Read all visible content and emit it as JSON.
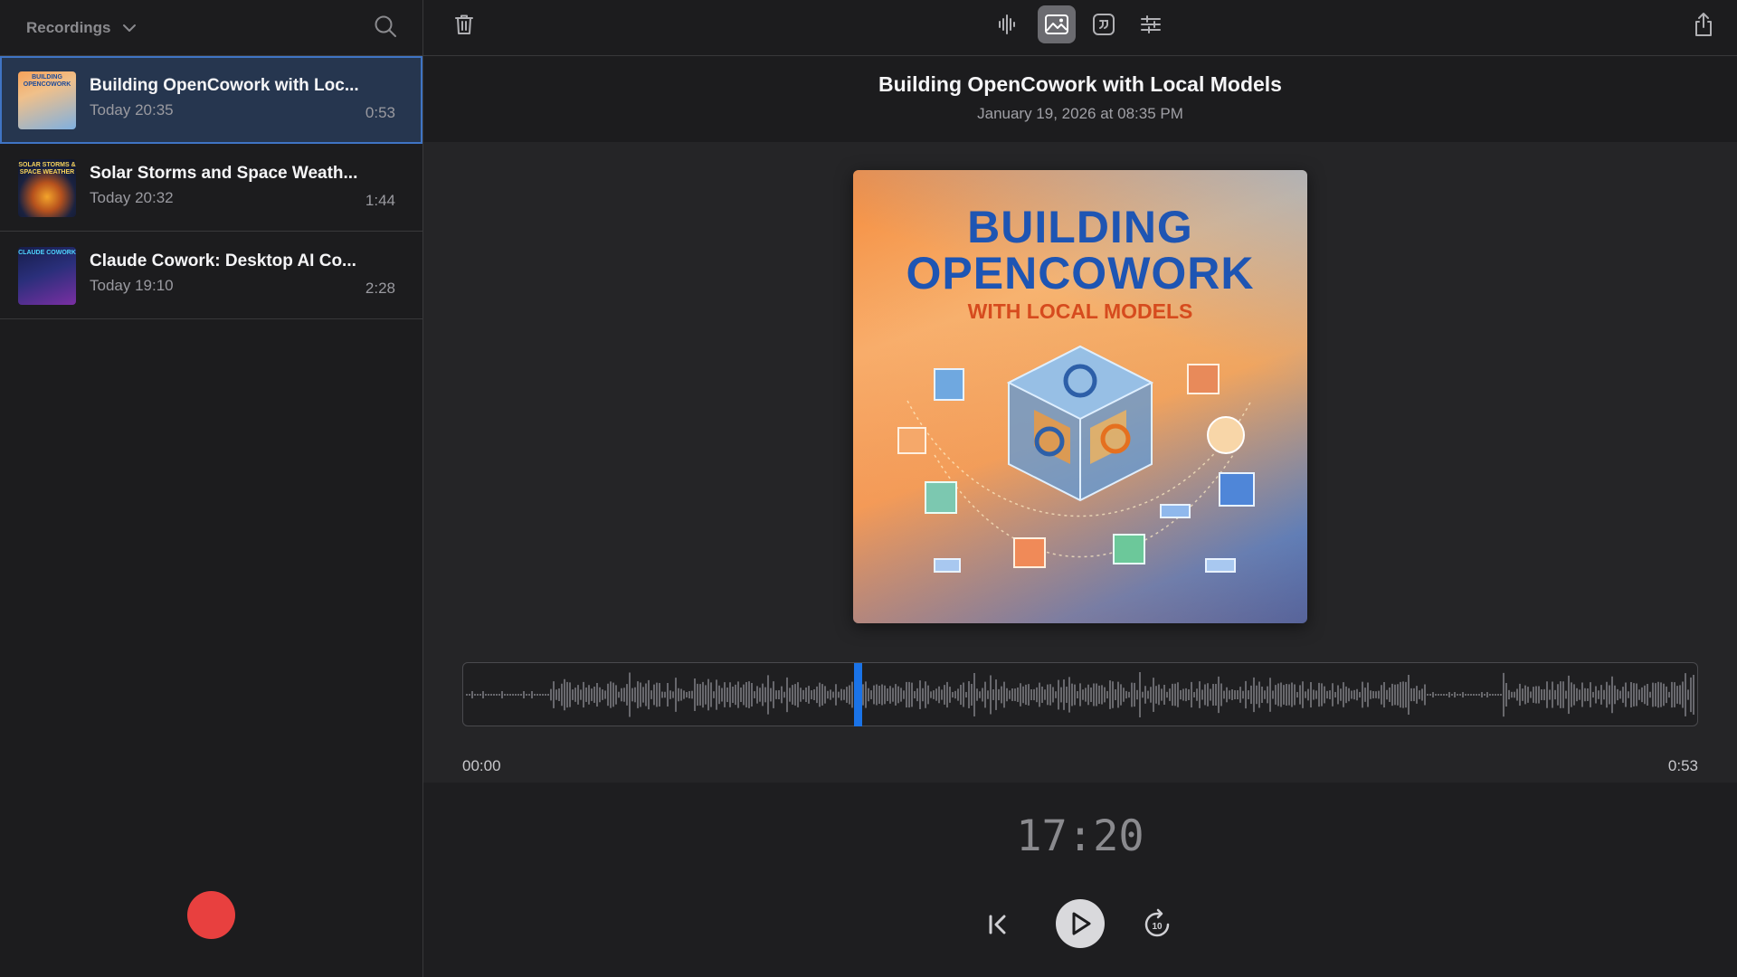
{
  "sidebar": {
    "header_label": "Recordings",
    "recordings": [
      {
        "title": "Building OpenCowork with Loc...",
        "date": "Today 20:35",
        "duration": "0:53",
        "thumb_text": "BUILDING OPENCOWORK"
      },
      {
        "title": "Solar Storms and Space Weath...",
        "date": "Today 20:32",
        "duration": "1:44",
        "thumb_text": "SOLAR STORMS & SPACE WEATHER"
      },
      {
        "title": "Claude Cowork: Desktop AI Co...",
        "date": "Today 19:10",
        "duration": "2:28",
        "thumb_text": "CLAUDE COWORK"
      }
    ]
  },
  "toolbar": {
    "icons": [
      "trash-icon",
      "waveform-icon",
      "image-icon",
      "quote-icon",
      "sliders-icon",
      "share-icon"
    ],
    "active_view": "image"
  },
  "recording": {
    "title": "Building OpenCowork with Local Models",
    "date": "January 19, 2026 at 08:35 PM"
  },
  "cover": {
    "line1": "BUILDING",
    "line2": "OPENCOWORK",
    "line3": "WITH LOCAL MODELS"
  },
  "playback": {
    "start_time": "00:00",
    "end_time": "0:53",
    "position_fraction": 0.32,
    "clock": "17:20"
  },
  "colors": {
    "accent": "#1a73e8",
    "record": "#e8403f",
    "selection": "#26364f"
  }
}
